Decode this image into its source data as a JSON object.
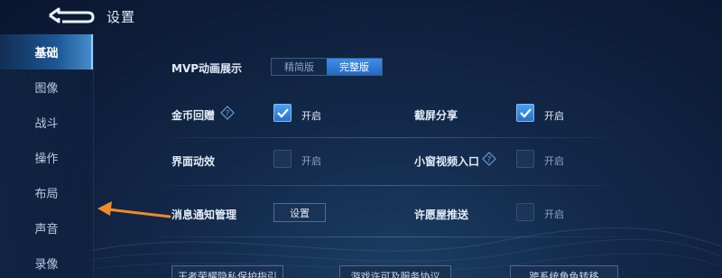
{
  "header": {
    "title": "设置"
  },
  "sidebar": {
    "items": [
      {
        "label": "基础",
        "active": true
      },
      {
        "label": "图像",
        "active": false
      },
      {
        "label": "战斗",
        "active": false
      },
      {
        "label": "操作",
        "active": false
      },
      {
        "label": "布局",
        "active": false
      },
      {
        "label": "声音",
        "active": false
      },
      {
        "label": "录像",
        "active": false
      }
    ]
  },
  "settings": {
    "mvp": {
      "label": "MVP动画展示",
      "options": [
        "精简版",
        "完整版"
      ],
      "selected": "完整版"
    },
    "gold_gift": {
      "label": "金币回赠",
      "state_label": "开启",
      "checked": true
    },
    "screenshot_share": {
      "label": "截屏分享",
      "state_label": "开启",
      "checked": true
    },
    "ui_effects": {
      "label": "界面动效",
      "state_label": "开启",
      "checked": false
    },
    "mini_video": {
      "label": "小窗视频入口",
      "state_label": "开启",
      "checked": false
    },
    "message_notify": {
      "label": "消息通知管理",
      "button_label": "设置"
    },
    "wish_push": {
      "label": "许愿屋推送",
      "state_label": "开启",
      "checked": false
    }
  },
  "footer": {
    "buttons": [
      "王者荣耀隐私保护指引",
      "游戏许可及服务协议",
      "跨系统角色转移"
    ]
  },
  "colors": {
    "accent": "#3d8fe6",
    "annotation_arrow": "#f08a2c",
    "background": "#13294a"
  }
}
